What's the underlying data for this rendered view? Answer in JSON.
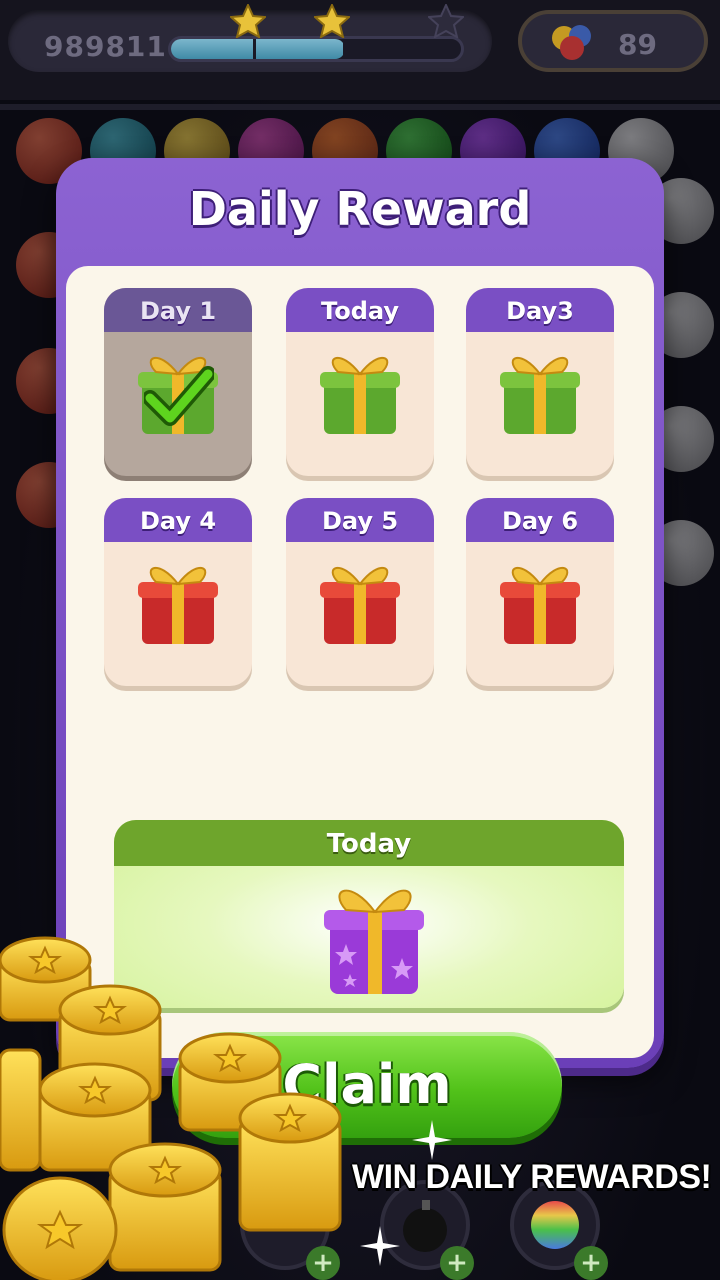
{
  "hud": {
    "score": "989811",
    "progress_fraction": 0.6,
    "stars_earned": 2,
    "stars_total": 3,
    "ball_count": "89"
  },
  "dialog": {
    "title": "Daily Reward",
    "days": [
      {
        "label": "Day 1",
        "state": "claimed",
        "gift": "green-gift"
      },
      {
        "label": "Today",
        "state": "current",
        "gift": "green-gift"
      },
      {
        "label": "Day3",
        "state": "locked",
        "gift": "green-gift"
      },
      {
        "label": "Day 4",
        "state": "locked",
        "gift": "red-gift"
      },
      {
        "label": "Day 5",
        "state": "locked",
        "gift": "red-gift"
      },
      {
        "label": "Day 6",
        "state": "locked",
        "gift": "red-gift"
      }
    ],
    "big_reward": {
      "label": "Today",
      "gift": "purple-star-gift"
    },
    "claim_label": "Claim"
  },
  "promo": {
    "text": "WIN DAILY REWARDS!"
  },
  "colors": {
    "dialog_purple": "#7a4fc4",
    "claim_green": "#52c21a",
    "big_card_header": "#6ea52c"
  }
}
